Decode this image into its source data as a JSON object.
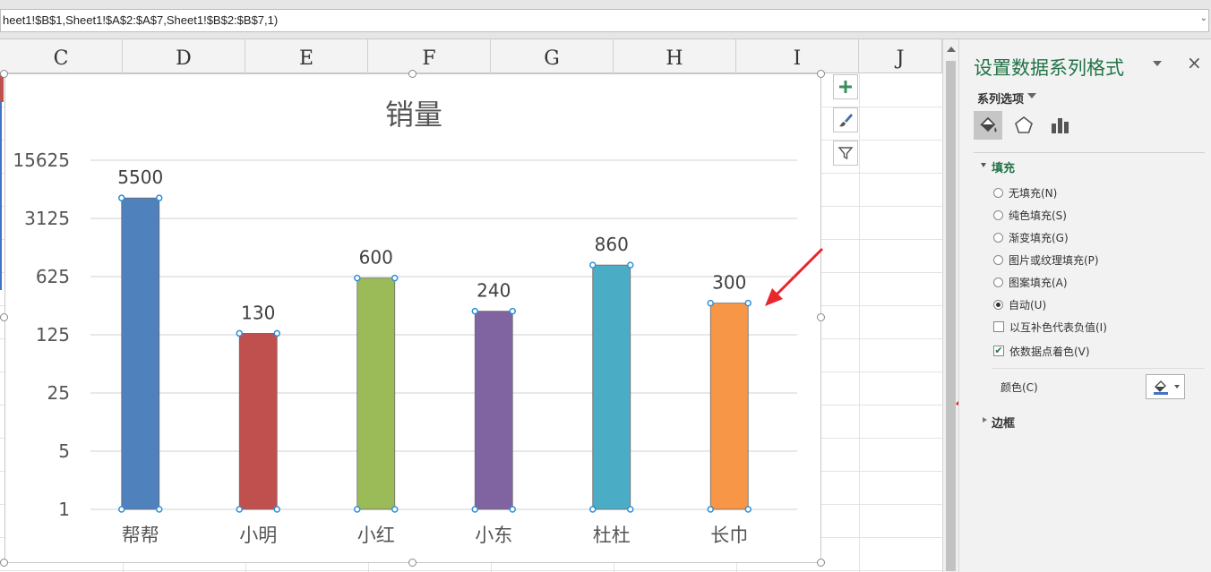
{
  "formula_bar": {
    "text": "heet1!$B$1,Sheet1!$A$2:$A$7,Sheet1!$B$2:$B$7,1)"
  },
  "columns": [
    "C",
    "D",
    "E",
    "F",
    "G",
    "H",
    "I",
    "J"
  ],
  "chart_data": {
    "type": "bar",
    "title": "销量",
    "categories": [
      "帮帮",
      "小明",
      "小红",
      "小东",
      "杜杜",
      "长巾"
    ],
    "values": [
      5500,
      130,
      600,
      240,
      860,
      300
    ],
    "colors": [
      "#4f81bd",
      "#c0504d",
      "#9bbb59",
      "#8064a2",
      "#4bacc6",
      "#f79646"
    ],
    "y_scale": "log",
    "y_log_base": 5,
    "y_ticks": [
      "1",
      "5",
      "25",
      "125",
      "625",
      "3125",
      "15625"
    ],
    "ylim": [
      1,
      15625
    ],
    "grid": true,
    "data_labels": true
  },
  "chart_buttons": [
    "plus-icon",
    "brush-icon",
    "filter-icon"
  ],
  "pane": {
    "title": "设置数据系列格式",
    "series_options_label": "系列选项",
    "fill_section": "填充",
    "fill_options": [
      {
        "label": "无填充(N)",
        "selected": false
      },
      {
        "label": "纯色填充(S)",
        "selected": false
      },
      {
        "label": "渐变填充(G)",
        "selected": false
      },
      {
        "label": "图片或纹理填充(P)",
        "selected": false
      },
      {
        "label": "图案填充(A)",
        "selected": false
      },
      {
        "label": "自动(U)",
        "selected": true
      }
    ],
    "invert_label": "以互补色代表负值(I)",
    "invert_checked": false,
    "vary_label": "依数据点着色(V)",
    "vary_checked": true,
    "color_label": "颜色(C)",
    "border_section": "边框"
  },
  "accent_color": "#217346",
  "annotation_color": "#e8262d"
}
